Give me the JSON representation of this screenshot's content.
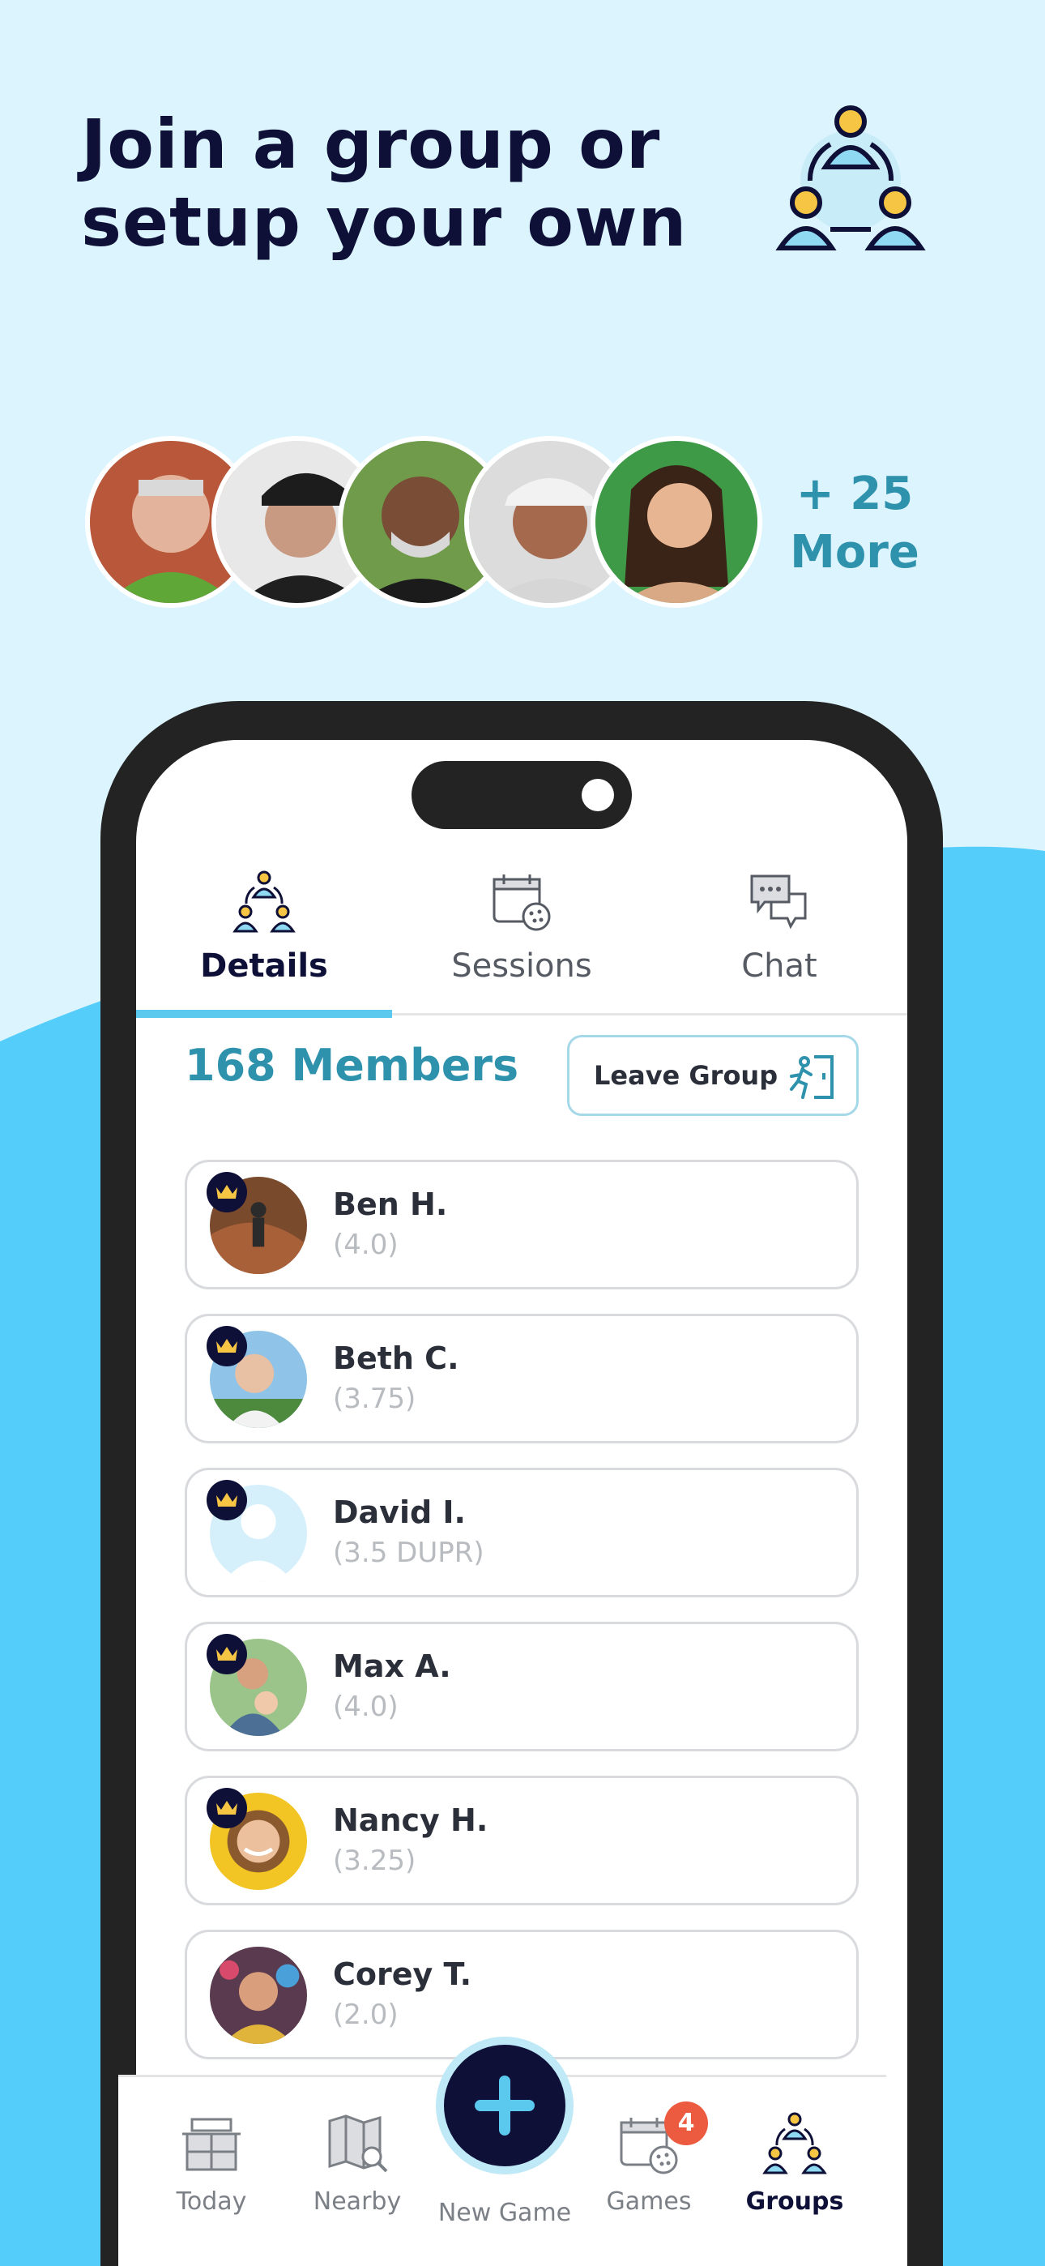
{
  "headline": "Join a group or setup your own",
  "more_text": "+ 25 More",
  "colors": {
    "navy": "#0e1038",
    "teal": "#2f92ad",
    "sky": "#5bc8ee",
    "pale": "#dcf4fd",
    "badge": "#ec5b3f"
  },
  "tabs": [
    {
      "label": "Details",
      "icon": "group-icon",
      "active": true
    },
    {
      "label": "Sessions",
      "icon": "calendar-ball-icon",
      "active": false
    },
    {
      "label": "Chat",
      "icon": "chat-bubbles-icon",
      "active": false
    }
  ],
  "members_title": "168 Members",
  "leave_button": "Leave Group",
  "members": [
    {
      "name": "Ben H.",
      "rating": "(4.0)",
      "admin": true
    },
    {
      "name": "Beth C.",
      "rating": "(3.75)",
      "admin": true
    },
    {
      "name": "David I.",
      "rating": "(3.5 DUPR)",
      "admin": true
    },
    {
      "name": "Max A.",
      "rating": "(4.0)",
      "admin": true
    },
    {
      "name": "Nancy H.",
      "rating": "(3.25)",
      "admin": true
    },
    {
      "name": "Corey T.",
      "rating": "(2.0)",
      "admin": false
    }
  ],
  "nav": {
    "today": "Today",
    "nearby": "Nearby",
    "new_game": "New Game",
    "games": "Games",
    "games_badge": "4",
    "groups": "Groups"
  }
}
